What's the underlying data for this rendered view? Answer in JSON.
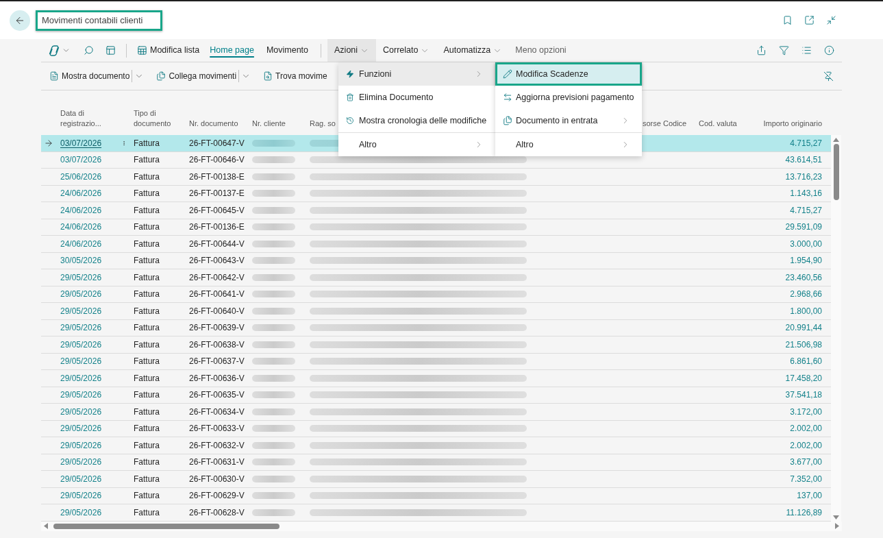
{
  "header": {
    "title": "Movimenti contabili clienti",
    "outlined": true
  },
  "action_bar": {
    "items": [
      {
        "kind": "command",
        "label": "Modifica lista"
      },
      {
        "kind": "tab",
        "label": "Home page",
        "selected": true
      },
      {
        "kind": "tab",
        "label": "Movimento",
        "selected": false
      },
      {
        "kind": "menu",
        "label": "Azioni",
        "expanded": true
      },
      {
        "kind": "menu",
        "label": "Correlato",
        "expanded": false
      },
      {
        "kind": "menu",
        "label": "Automatizza",
        "expanded": false
      },
      {
        "kind": "link",
        "label": "Meno opzioni"
      }
    ]
  },
  "promoted_actions": [
    {
      "label": "Mostra documento",
      "split": true
    },
    {
      "label": "Collega movimenti",
      "split": true
    },
    {
      "label": "Trova movime",
      "split": false
    }
  ],
  "actions_menu": {
    "groups": [
      {
        "items": [
          {
            "label": "Funzioni",
            "submenu": true,
            "selected": true
          },
          {
            "label": "Elimina Documento",
            "submenu": false,
            "selected": false
          },
          {
            "label": "Mostra cronologia delle modifiche",
            "submenu": false,
            "selected": false
          }
        ]
      },
      {
        "items": [
          {
            "label": "Altro",
            "submenu": true,
            "selected": false
          }
        ]
      }
    ]
  },
  "functions_submenu": {
    "groups": [
      {
        "items": [
          {
            "label": "Modifica Scadenze",
            "submenu": false,
            "selected": true,
            "outlined": true
          },
          {
            "label": "Aggiorna previsioni pagamento",
            "submenu": false,
            "selected": false,
            "outlined": false
          },
          {
            "label": "Documento in entrata",
            "submenu": true,
            "selected": false,
            "outlined": false
          }
        ]
      },
      {
        "items": [
          {
            "label": "Altro",
            "submenu": true,
            "selected": false,
            "outlined": false
          }
        ]
      }
    ]
  },
  "table": {
    "columns": [
      {
        "label": "Data di registrazio...",
        "redacted": false
      },
      {
        "label": "Tipo di documento",
        "redacted": false
      },
      {
        "label": "Nr. documento",
        "redacted": false
      },
      {
        "label": "Nr. cliente",
        "redacted": true
      },
      {
        "label": "Rag. so",
        "redacted": true
      },
      {
        "label": "sorse Codice",
        "redacted": false
      },
      {
        "label": "Cod. valuta",
        "redacted": false
      },
      {
        "label": "Importo originario",
        "redacted": false
      }
    ],
    "rows": [
      {
        "date": "03/07/2026",
        "document_type": "Fattura",
        "document_no": "26-FT-00647-V",
        "original_amount": "4.715,27",
        "selected": true
      },
      {
        "date": "03/07/2026",
        "document_type": "Fattura",
        "document_no": "26-FT-00646-V",
        "original_amount": "43.614,51",
        "selected": false
      },
      {
        "date": "25/06/2026",
        "document_type": "Fattura",
        "document_no": "26-FT-00138-E",
        "original_amount": "13.716,23",
        "selected": false
      },
      {
        "date": "24/06/2026",
        "document_type": "Fattura",
        "document_no": "26-FT-00137-E",
        "original_amount": "1.143,16",
        "selected": false
      },
      {
        "date": "24/06/2026",
        "document_type": "Fattura",
        "document_no": "26-FT-00645-V",
        "original_amount": "4.715,27",
        "selected": false
      },
      {
        "date": "24/06/2026",
        "document_type": "Fattura",
        "document_no": "26-FT-00136-E",
        "original_amount": "29.591,09",
        "selected": false
      },
      {
        "date": "24/06/2026",
        "document_type": "Fattura",
        "document_no": "26-FT-00644-V",
        "original_amount": "3.000,00",
        "selected": false
      },
      {
        "date": "30/05/2026",
        "document_type": "Fattura",
        "document_no": "26-FT-00643-V",
        "original_amount": "1.954,90",
        "selected": false
      },
      {
        "date": "29/05/2026",
        "document_type": "Fattura",
        "document_no": "26-FT-00642-V",
        "original_amount": "23.460,56",
        "selected": false
      },
      {
        "date": "29/05/2026",
        "document_type": "Fattura",
        "document_no": "26-FT-00641-V",
        "original_amount": "2.968,66",
        "selected": false
      },
      {
        "date": "29/05/2026",
        "document_type": "Fattura",
        "document_no": "26-FT-00640-V",
        "original_amount": "1.800,00",
        "selected": false
      },
      {
        "date": "29/05/2026",
        "document_type": "Fattura",
        "document_no": "26-FT-00639-V",
        "original_amount": "20.991,44",
        "selected": false
      },
      {
        "date": "29/05/2026",
        "document_type": "Fattura",
        "document_no": "26-FT-00638-V",
        "original_amount": "21.506,98",
        "selected": false
      },
      {
        "date": "29/05/2026",
        "document_type": "Fattura",
        "document_no": "26-FT-00637-V",
        "original_amount": "6.861,60",
        "selected": false
      },
      {
        "date": "29/05/2026",
        "document_type": "Fattura",
        "document_no": "26-FT-00636-V",
        "original_amount": "17.458,20",
        "selected": false
      },
      {
        "date": "29/05/2026",
        "document_type": "Fattura",
        "document_no": "26-FT-00635-V",
        "original_amount": "37.541,18",
        "selected": false
      },
      {
        "date": "29/05/2026",
        "document_type": "Fattura",
        "document_no": "26-FT-00634-V",
        "original_amount": "3.172,00",
        "selected": false
      },
      {
        "date": "29/05/2026",
        "document_type": "Fattura",
        "document_no": "26-FT-00633-V",
        "original_amount": "2.002,00",
        "selected": false
      },
      {
        "date": "29/05/2026",
        "document_type": "Fattura",
        "document_no": "26-FT-00632-V",
        "original_amount": "2.002,00",
        "selected": false
      },
      {
        "date": "29/05/2026",
        "document_type": "Fattura",
        "document_no": "26-FT-00631-V",
        "original_amount": "3.677,00",
        "selected": false
      },
      {
        "date": "29/05/2026",
        "document_type": "Fattura",
        "document_no": "26-FT-00630-V",
        "original_amount": "7.352,00",
        "selected": false
      },
      {
        "date": "29/05/2026",
        "document_type": "Fattura",
        "document_no": "26-FT-00629-V",
        "original_amount": "137,00",
        "selected": false
      },
      {
        "date": "29/05/2026",
        "document_type": "Fattura",
        "document_no": "26-FT-00628-V",
        "original_amount": "11.126,89",
        "selected": false
      }
    ]
  }
}
